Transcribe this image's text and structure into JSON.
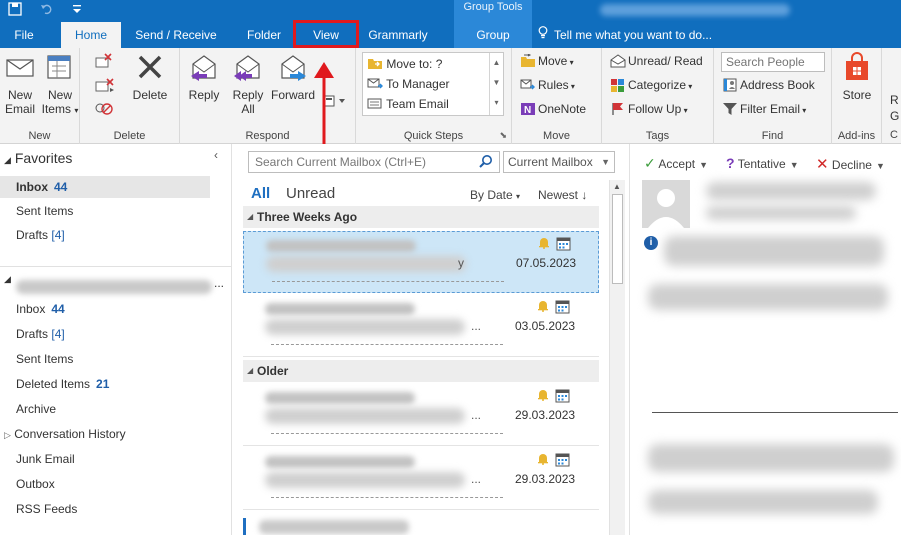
{
  "window": {
    "group_tools_label": "Group Tools"
  },
  "tabs": [
    {
      "label": "File"
    },
    {
      "label": "Home"
    },
    {
      "label": "Send / Receive"
    },
    {
      "label": "Folder"
    },
    {
      "label": "View"
    },
    {
      "label": "Grammarly"
    },
    {
      "label": "Group"
    }
  ],
  "tell_me": "Tell me what you want to do...",
  "ribbon": {
    "new": {
      "label": "New",
      "new_email_1": "New",
      "new_email_2": "Email",
      "new_items_1": "New",
      "new_items_2": "Items"
    },
    "delete": {
      "label": "Delete",
      "delete_btn": "Delete"
    },
    "respond": {
      "label": "Respond",
      "reply": "Reply",
      "reply_all_1": "Reply",
      "reply_all_2": "All",
      "forward": "Forward"
    },
    "quick_steps": {
      "label": "Quick Steps",
      "items": [
        "Move to: ?",
        "To Manager",
        "Team Email"
      ]
    },
    "move": {
      "label": "Move",
      "move": "Move",
      "rules": "Rules",
      "onenote": "OneNote"
    },
    "tags": {
      "label": "Tags",
      "unread_read": "Unread/ Read",
      "categorize": "Categorize",
      "follow_up": "Follow Up"
    },
    "find": {
      "label": "Find",
      "search_people_placeholder": "Search People",
      "address_book": "Address Book",
      "filter_email": "Filter Email"
    },
    "addins": {
      "label": "Add-ins",
      "store": "Store"
    },
    "cut_off": {
      "r": "R",
      "g": "G",
      "c": "C"
    }
  },
  "folders": {
    "favorites_header": "Favorites",
    "favorites": [
      {
        "name": "Inbox",
        "count": "44"
      },
      {
        "name": "Sent Items"
      },
      {
        "name": "Drafts",
        "count_bracket": "[4]"
      }
    ],
    "account_dots": "...",
    "account": [
      {
        "name": "Inbox",
        "count": "44"
      },
      {
        "name": "Drafts",
        "count_bracket": "[4]"
      },
      {
        "name": "Sent Items"
      },
      {
        "name": "Deleted Items",
        "count": "21"
      },
      {
        "name": "Archive"
      },
      {
        "name": "Conversation History"
      },
      {
        "name": "Junk Email"
      },
      {
        "name": "Outbox"
      },
      {
        "name": "RSS Feeds"
      }
    ]
  },
  "message_list": {
    "search_placeholder": "Search Current Mailbox (Ctrl+E)",
    "scope": "Current Mailbox",
    "filter_all": "All",
    "filter_unread": "Unread",
    "sort_by": "By Date",
    "sort_order": "Newest",
    "groups": [
      {
        "label": "Three Weeks Ago"
      },
      {
        "label": "Older"
      }
    ],
    "messages": [
      {
        "date": "07.05.2023",
        "dots": "y"
      },
      {
        "date": "03.05.2023",
        "dots": "..."
      },
      {
        "date": "29.03.2023",
        "dots": "..."
      },
      {
        "date": "29.03.2023",
        "dots": "..."
      }
    ]
  },
  "reading_pane": {
    "accept": "Accept",
    "tentative": "Tentative",
    "decline": "Decline"
  },
  "colors": {
    "accent": "#106ebe",
    "highlight_red": "#e0191d"
  }
}
